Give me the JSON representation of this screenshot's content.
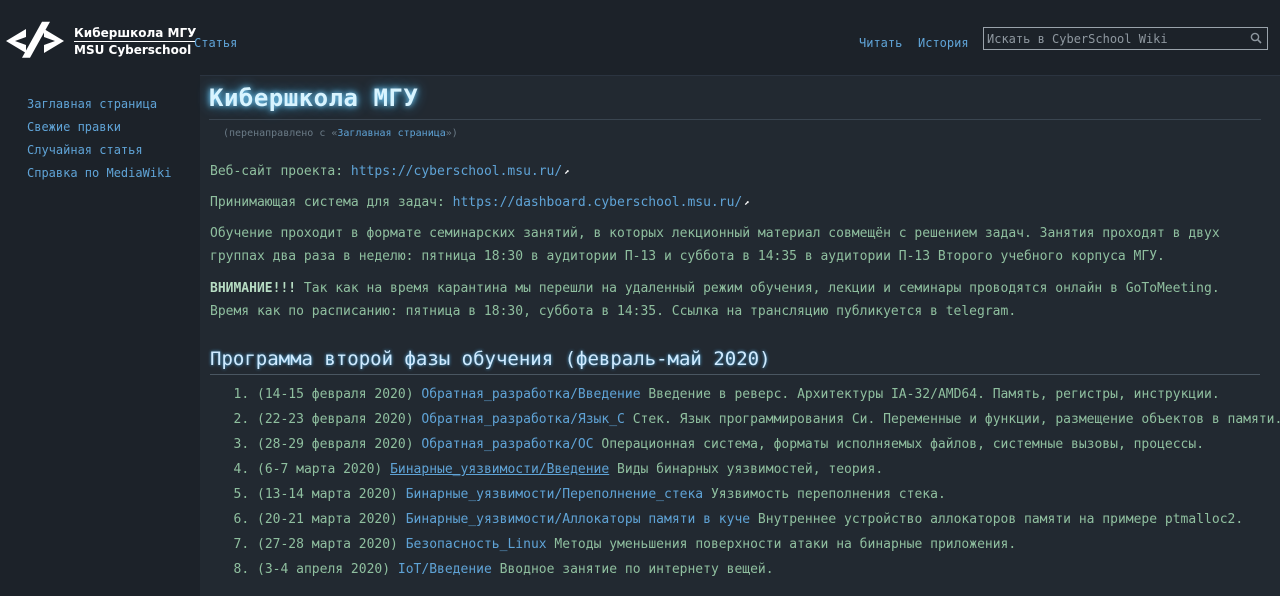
{
  "brand": {
    "line1": "Кибершкола МГУ",
    "line2": "MSU Cyberschool"
  },
  "top_nav": {
    "article": "Статья",
    "read": "Читать",
    "history": "История"
  },
  "search": {
    "placeholder": "Искать в CyberSchool Wiki"
  },
  "sidebar": {
    "items": [
      {
        "label": "Заглавная страница"
      },
      {
        "label": "Свежие правки"
      },
      {
        "label": "Случайная статья"
      },
      {
        "label": "Справка по MediaWiki"
      }
    ]
  },
  "page": {
    "title": "Кибершкола МГУ",
    "redirect_prefix": "(перенаправлено с «",
    "redirect_link": "Заглавная страница",
    "redirect_suffix": "»)",
    "website_label": "Веб-сайт проекта: ",
    "website_url": "https://cyberschool.msu.ru/",
    "dashboard_label": "Принимающая система для задач: ",
    "dashboard_url": "https://dashboard.cyberschool.msu.ru/",
    "schedule_text": "Обучение проходит в формате семинарских занятий, в которых лекционный материал совмещён с решением задач. Занятия проходят в двух группах два раза в неделю: пятница 18:30 в аудитории П-13 и суббота в 14:35 в аудитории П-13 Второго учебного корпуса МГУ.",
    "warning_label": "ВНИМАНИЕ!!!",
    "warning_text": " Так как на время карантина мы перешли на удаленный режим обучения, лекции и семинары проводятся онлайн в GoToMeeting. Время как по расписанию: пятница в 18:30, суббота в 14:35. Ссылка на трансляцию публикуется в telegram.",
    "program_heading": "Программа второй фазы обучения (февраль-май 2020)"
  },
  "program": [
    {
      "date": "(14-15 февраля 2020)",
      "link": "Обратная_разработка/Введение",
      "desc": " Введение в реверс. Архитектуры IA-32/AMD64. Память, регистры, инструкции."
    },
    {
      "date": "(22-23 февраля 2020)",
      "link": "Обратная_разработка/Язык_C",
      "desc": " Стек. Язык программирования Си. Переменные и функции, размещение объектов в памяти."
    },
    {
      "date": "(28-29 февраля 2020)",
      "link": "Обратная_разработка/ОС",
      "desc": " Операционная система, форматы исполняемых файлов, системные вызовы, процессы."
    },
    {
      "date": "(6-7 марта 2020)",
      "link": "Бинарные_уязвимости/Введение",
      "desc": " Виды бинарных уязвимостей, теория."
    },
    {
      "date": "(13-14 марта 2020)",
      "link": "Бинарные_уязвимости/Переполнение_стека",
      "desc": " Уязвимость переполнения стека."
    },
    {
      "date": "(20-21 марта 2020)",
      "link": "Бинарные_уязвимости/Аллокаторы памяти в куче",
      "desc": " Внутреннее устройство аллокаторов памяти на примере ptmalloc2."
    },
    {
      "date": "(27-28 марта 2020)",
      "link": "Безопасность_Linux",
      "desc": " Методы уменьшения поверхности атаки на бинарные приложения."
    },
    {
      "date": "(3-4 апреля 2020)",
      "link": "IoT/Введение",
      "desc": " Вводное занятие по интернету вещей."
    }
  ],
  "colors": {
    "background": "#1c2229",
    "content_bg": "#222931",
    "text": "#8fbf9f",
    "link": "#5fa3d6",
    "title_glow": "#7fd4ff"
  },
  "icons": {
    "logo": "cyberschool-logo-icon",
    "search": "search-icon",
    "external": "external-link-icon"
  }
}
